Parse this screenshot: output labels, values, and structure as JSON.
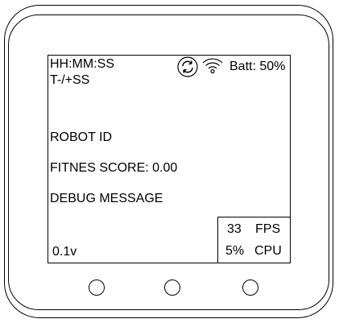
{
  "screen": {
    "clock": "HH:MM:SS",
    "timer": "T-/+SS",
    "robot_id": "ROBOT ID",
    "fitness": "FITNES SCORE: 0.00",
    "debug": "DEBUG MESSAGE",
    "version": "0.1v",
    "battery": "Batt: 50%",
    "status_icons": [
      "sync-icon",
      "wifi-icon"
    ]
  },
  "stats": {
    "fps_value": "33",
    "fps_label": "FPS",
    "cpu_value": "5%",
    "cpu_label": "CPU"
  },
  "buttons": [
    "left-button",
    "middle-button",
    "right-button"
  ]
}
